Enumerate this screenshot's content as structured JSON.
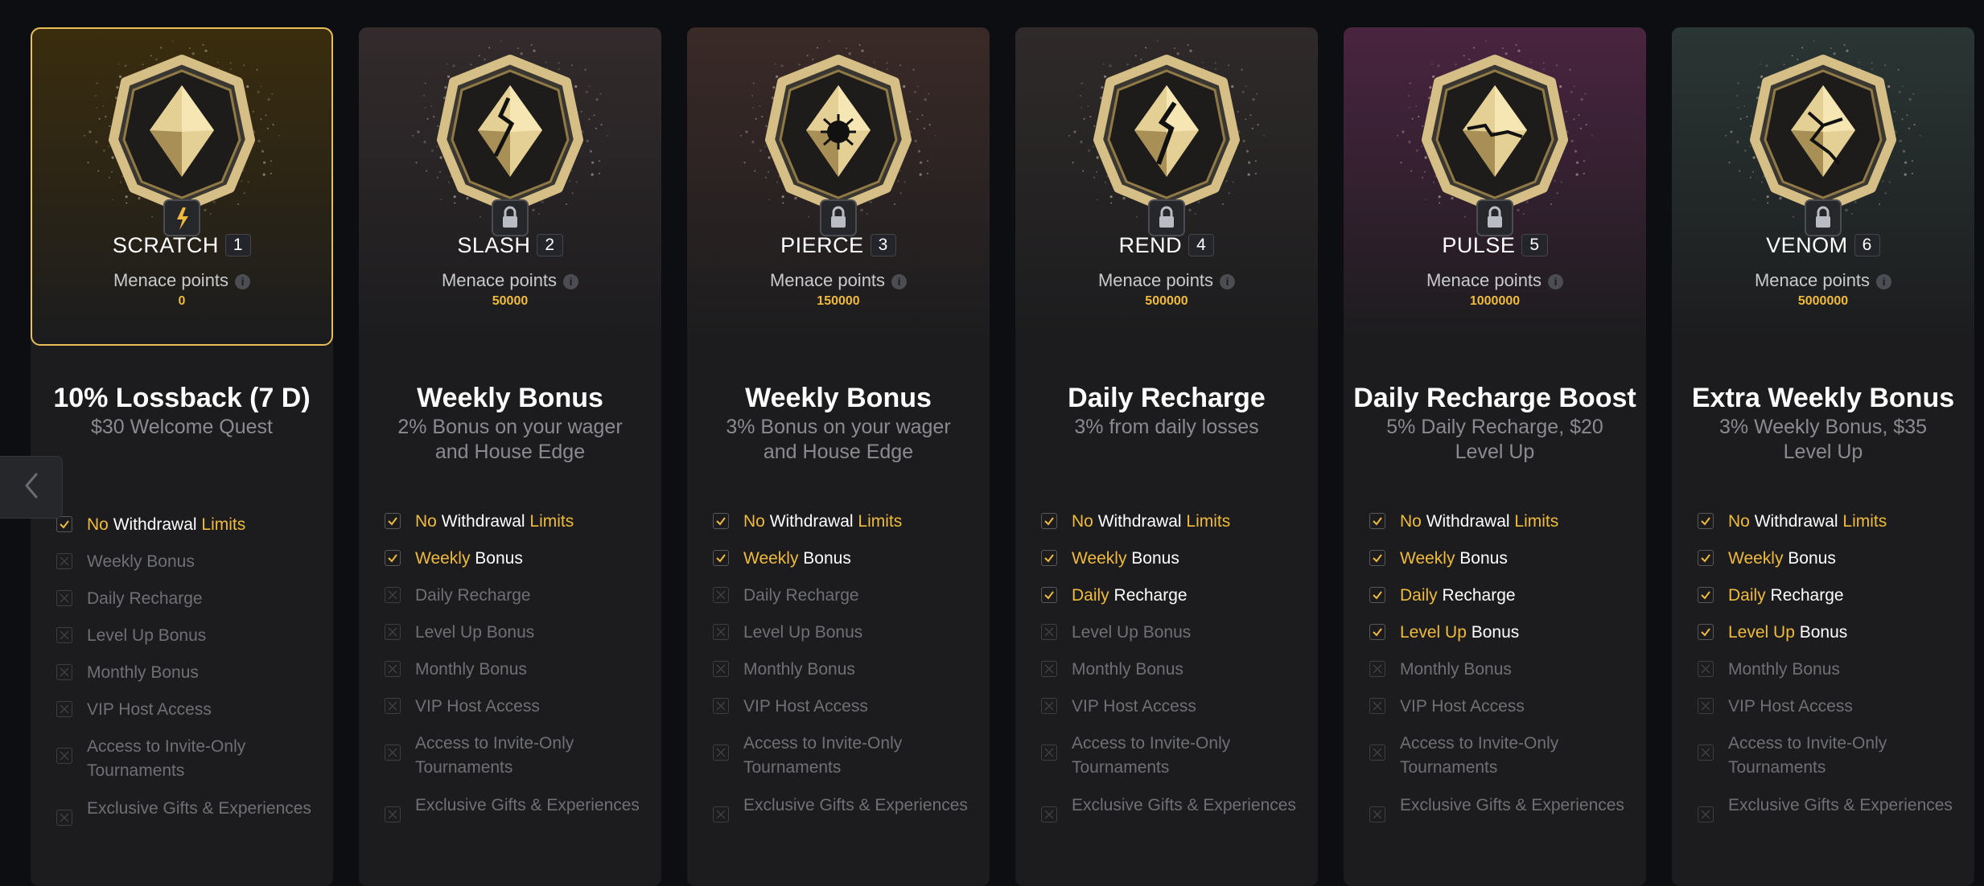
{
  "nav": {
    "prev_icon": "chevron-left-icon"
  },
  "tiers": [
    {
      "rank": "SCRATCH",
      "num": "1",
      "menace_label": "Menace points",
      "points": "0",
      "lock_icon": "lightning-icon",
      "accent": "#e7bf5a",
      "perk_title": "10% Lossback (7 D)",
      "perk_sub": "$30 Welcome Quest"
    },
    {
      "rank": "SLASH",
      "num": "2",
      "menace_label": "Menace points",
      "points": "50000",
      "lock_icon": "lock-icon",
      "perk_title": "Weekly Bonus",
      "perk_sub": "2% Bonus on your wager and House Edge"
    },
    {
      "rank": "PIERCE",
      "num": "3",
      "menace_label": "Menace points",
      "points": "150000",
      "lock_icon": "lock-icon",
      "perk_title": "Weekly Bonus",
      "perk_sub": "3% Bonus on your wager and House Edge"
    },
    {
      "rank": "REND",
      "num": "4",
      "menace_label": "Menace points",
      "points": "500000",
      "lock_icon": "lock-icon",
      "perk_title": "Daily Recharge",
      "perk_sub": "3% from daily losses"
    },
    {
      "rank": "PULSE",
      "num": "5",
      "menace_label": "Menace points",
      "points": "1000000",
      "lock_icon": "lock-icon",
      "perk_title": "Daily Recharge Boost",
      "perk_sub": "5% Daily Recharge, $20 Level Up"
    },
    {
      "rank": "VENOM",
      "num": "6",
      "menace_label": "Menace points",
      "points": "5000000",
      "lock_icon": "lock-icon",
      "perk_title": "Extra Weekly Bonus",
      "perk_sub": "3% Weekly Bonus, $35 Level Up"
    }
  ],
  "features": {
    "no_withdrawal": {
      "a": "No",
      "b": " Withdrawal ",
      "c": "Limits"
    },
    "weekly_bonus": {
      "a": "Weekly",
      "b": " Bonus",
      "full": "Weekly Bonus"
    },
    "daily_recharge": {
      "a": "Daily",
      "b": " Recharge",
      "full": "Daily Recharge"
    },
    "level_up_bonus": {
      "a": "Level Up",
      "b": " Bonus",
      "full": "Level Up Bonus"
    },
    "monthly_bonus": {
      "full": "Monthly Bonus"
    },
    "vip_host": {
      "full": "VIP Host Access"
    },
    "invite_only": {
      "full": "Access to Invite-Only Tournaments"
    },
    "exclusive_gifts": {
      "full": "Exclusive Gifts & Experiences"
    }
  },
  "unlocked_counts": [
    1,
    2,
    2,
    3,
    4,
    4
  ],
  "colors": {
    "gold": "#f0bb3c",
    "active_border": "#e7bf5a",
    "header_tints": [
      "#3a2d0e",
      "#332b2c",
      "#3a2a27",
      "#2f2a29",
      "#4a2440",
      "#2a3634"
    ]
  }
}
